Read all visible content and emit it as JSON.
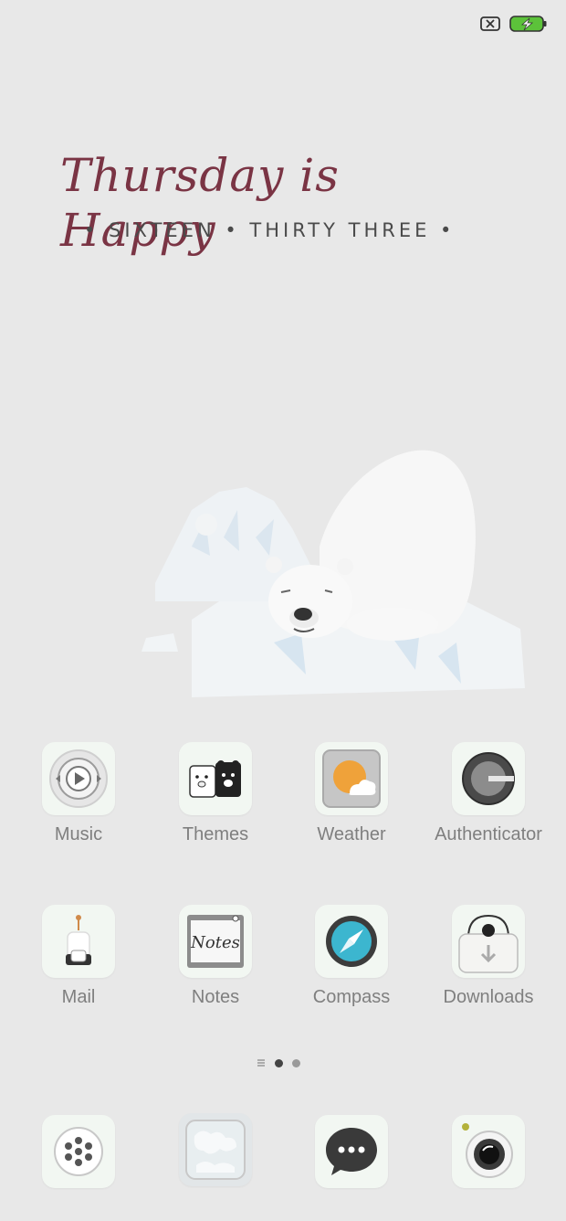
{
  "status_bar": {
    "sim_icon": "no-sim-icon",
    "battery_icon": "battery-charging-icon"
  },
  "clock_widget": {
    "day_phrase": "Thursday is Happy",
    "time_words": "• SIXTEEN • THIRTY THREE •"
  },
  "wallpaper": {
    "subject": "polar-bear-on-ice"
  },
  "apps_row1": [
    {
      "label": "Music",
      "icon": "music-player-icon"
    },
    {
      "label": "Themes",
      "icon": "bears-icon"
    },
    {
      "label": "Weather",
      "icon": "sun-cloud-icon"
    },
    {
      "label": "Authenticator",
      "icon": "authenticator-icon"
    }
  ],
  "apps_row2": [
    {
      "label": "Mail",
      "icon": "mailbox-icon"
    },
    {
      "label": "Notes",
      "icon": "notes-icon"
    },
    {
      "label": "Compass",
      "icon": "compass-icon"
    },
    {
      "label": "Downloads",
      "icon": "downloads-icon"
    }
  ],
  "page_indicator": {
    "pages": 2,
    "current": 1
  },
  "dock": [
    {
      "icon": "phone-dialpad-icon"
    },
    {
      "icon": "gallery-icon"
    },
    {
      "icon": "messages-icon"
    },
    {
      "icon": "camera-icon"
    }
  ],
  "colors": {
    "background": "#e8e8e8",
    "headline": "#7a3444",
    "label": "#7f7f7f",
    "battery": "#5cc23a"
  }
}
